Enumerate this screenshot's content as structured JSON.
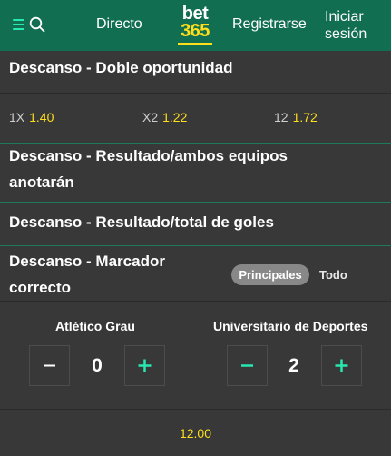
{
  "header": {
    "nav_directo": "Directo",
    "logo_top": "bet",
    "logo_bottom": "365",
    "nav_registrarse": "Registrarse",
    "nav_login_line1": "Iniciar",
    "nav_login_line2": "sesión",
    "colors": {
      "background": "#126e51",
      "accent": "#27e8b0",
      "brand_yellow": "#ffdf1b"
    },
    "icons": [
      "menu-icon",
      "search-icon"
    ]
  },
  "markets": {
    "doble_oportunidad": {
      "title": "Descanso - Doble oportunidad",
      "odds": [
        {
          "label": "1X",
          "value": "1.40"
        },
        {
          "label": "X2",
          "value": "1.22"
        },
        {
          "label": "12",
          "value": "1.72"
        }
      ]
    },
    "resultado_ambos": {
      "title_line1": "Descanso - Resultado/ambos equipos",
      "title_line2": "anotarán"
    },
    "resultado_total": {
      "title": "Descanso - Resultado/total de goles"
    },
    "marcador_correcto": {
      "title_line1": "Descanso - Marcador",
      "title_line2": "correcto",
      "filters": {
        "principales": "Principales",
        "todo": "Todo"
      },
      "teams": [
        {
          "name": "Atlético Grau",
          "score": "0"
        },
        {
          "name": "Universitario de Deportes",
          "score": "2"
        }
      ],
      "odds": "12.00"
    }
  }
}
